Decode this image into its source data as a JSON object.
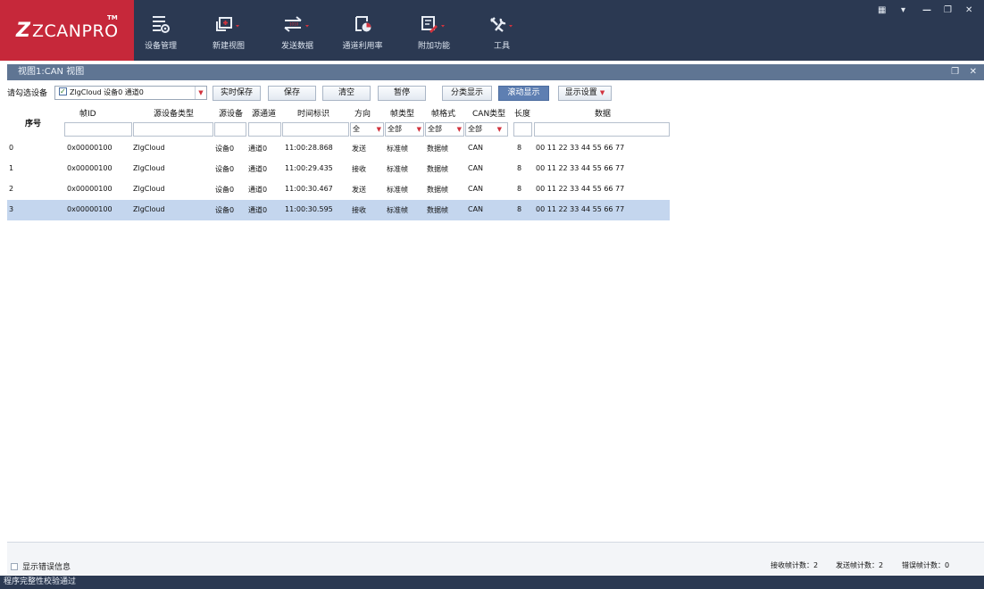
{
  "app": {
    "logo_text": "ZCANPRO",
    "logo_tm": "TM"
  },
  "toolbar": [
    {
      "label": "设备管理",
      "icon": "device-manage-icon",
      "has_arrow": false
    },
    {
      "label": "新建视图",
      "icon": "new-view-icon",
      "has_arrow": true
    },
    {
      "label": "发送数据",
      "icon": "send-data-icon",
      "has_arrow": true
    },
    {
      "label": "通道利用率",
      "icon": "channel-usage-icon",
      "has_arrow": false
    },
    {
      "label": "附加功能",
      "icon": "addon-icon",
      "has_arrow": true
    },
    {
      "label": "工具",
      "icon": "tools-icon",
      "has_arrow": true
    }
  ],
  "view": {
    "title": "视图1:CAN 视图"
  },
  "controls": {
    "device_prompt": "请勾选设备",
    "device_selected": "ZlgCloud 设备0 通道0",
    "buttons": [
      "实时保存",
      "保存",
      "清空",
      "暂停",
      "分类显示",
      "滚动显示",
      "显示设置"
    ],
    "active_button": "滚动显示"
  },
  "table": {
    "columns": {
      "index": "序号",
      "frame_id": "帧ID",
      "source_type": "源设备类型",
      "source_device": "源设备",
      "source_channel": "源通道",
      "timestamp": "时间标识",
      "direction": "方向",
      "frame_type": "帧类型",
      "frame_format": "帧格式",
      "can_type": "CAN类型",
      "length": "长度",
      "data": "数据"
    },
    "filters": {
      "direction": "全",
      "frame_type": "全部",
      "frame_format": "全部",
      "can_type": "全部"
    },
    "rows": [
      {
        "index": "0",
        "frame_id": "0x00000100",
        "source_type": "ZlgCloud",
        "source_device": "设备0",
        "source_channel": "通道0",
        "timestamp": "11:00:28.868",
        "direction": "发送",
        "frame_type": "标准帧",
        "frame_format": "数据帧",
        "can_type": "CAN",
        "length": "8",
        "data": "00 11 22 33 44 55 66 77"
      },
      {
        "index": "1",
        "frame_id": "0x00000100",
        "source_type": "ZlgCloud",
        "source_device": "设备0",
        "source_channel": "通道0",
        "timestamp": "11:00:29.435",
        "direction": "接收",
        "frame_type": "标准帧",
        "frame_format": "数据帧",
        "can_type": "CAN",
        "length": "8",
        "data": "00 11 22 33 44 55 66 77"
      },
      {
        "index": "2",
        "frame_id": "0x00000100",
        "source_type": "ZlgCloud",
        "source_device": "设备0",
        "source_channel": "通道0",
        "timestamp": "11:00:30.467",
        "direction": "发送",
        "frame_type": "标准帧",
        "frame_format": "数据帧",
        "can_type": "CAN",
        "length": "8",
        "data": "00 11 22 33 44 55 66 77"
      },
      {
        "index": "3",
        "frame_id": "0x00000100",
        "source_type": "ZlgCloud",
        "source_device": "设备0",
        "source_channel": "通道0",
        "timestamp": "11:00:30.595",
        "direction": "接收",
        "frame_type": "标准帧",
        "frame_format": "数据帧",
        "can_type": "CAN",
        "length": "8",
        "data": "00 11 22 33 44 55 66 77"
      }
    ],
    "selected_row": "3"
  },
  "bottom": {
    "show_error_label": "显示错误信息",
    "rx_count_label": "接收帧计数：2",
    "tx_count_label": "发送帧计数：2",
    "err_count_label": "错误帧计数：0"
  },
  "status": {
    "text": "程序完整性校验通过"
  },
  "colors": {
    "ribbon": "#2b3952",
    "logo_bg": "#c6283a",
    "view_bar": "#5f7593",
    "selected_row": "#c4d6ee",
    "active_button": "#5e7fb2"
  }
}
